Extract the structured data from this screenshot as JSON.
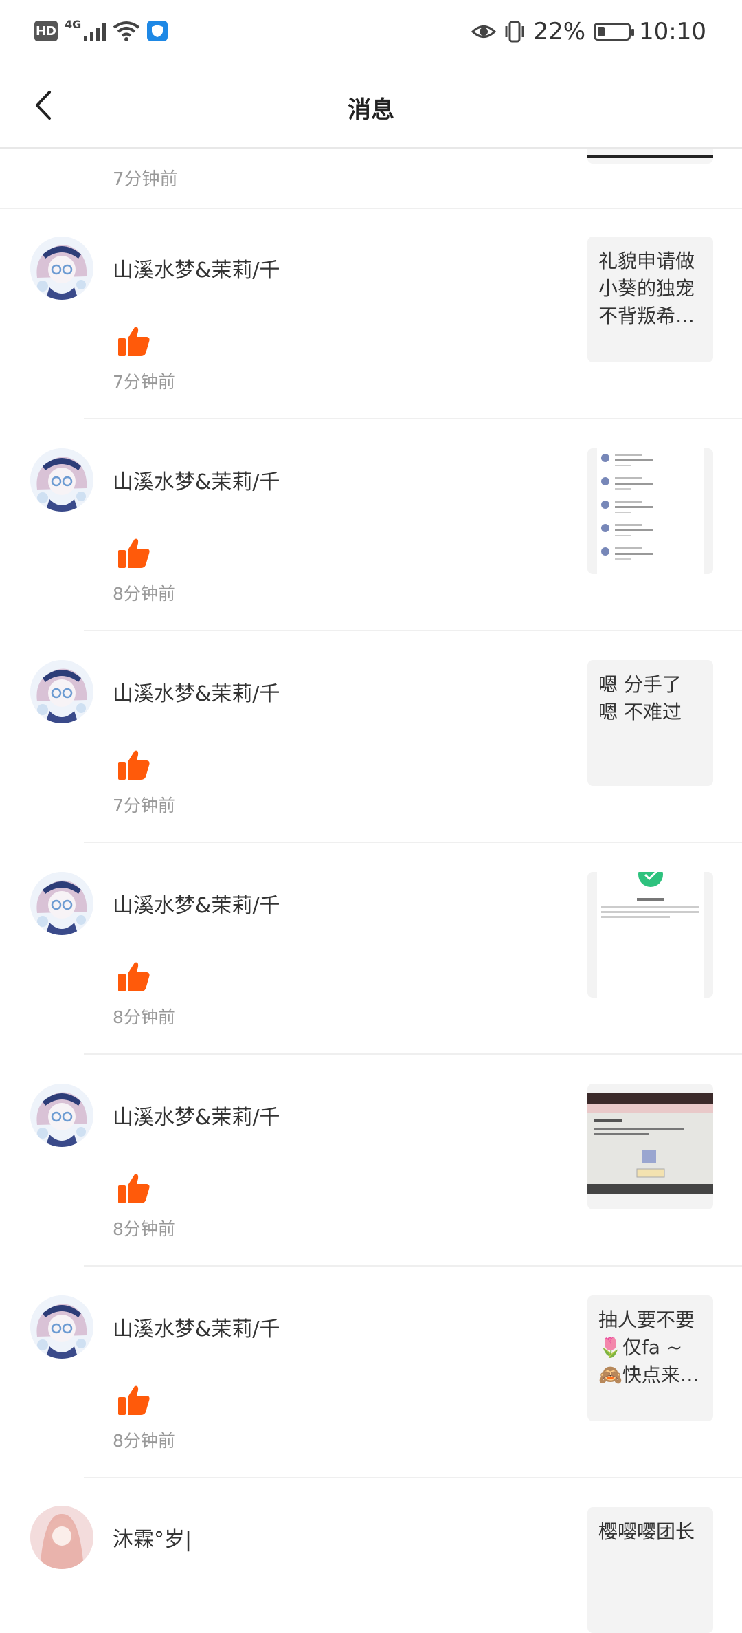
{
  "status_bar": {
    "hd": "HD",
    "network": "4G",
    "battery_percent": "22%",
    "battery_level": 0.22,
    "time": "10:10",
    "icons": [
      "signal-icon",
      "wifi-icon",
      "shield-app-icon",
      "eye-icon",
      "vibrate-icon",
      "battery-icon"
    ]
  },
  "header": {
    "title": "消息",
    "back_icon": "chevron-left-icon"
  },
  "top_partial": {
    "time": "7分钟前"
  },
  "items": [
    {
      "name": "山溪水梦&茉莉/千",
      "time": "7分钟前",
      "thumb_type": "text",
      "thumb_text": "礼貌申请做\n小葵的独宠\n不背叛希…"
    },
    {
      "name": "山溪水梦&茉莉/千",
      "time": "8分钟前",
      "thumb_type": "image-chatlist",
      "thumb_text": ""
    },
    {
      "name": "山溪水梦&茉莉/千",
      "time": "7分钟前",
      "thumb_type": "text",
      "thumb_text": "嗯   分手了\n嗯   不难过"
    },
    {
      "name": "山溪水梦&茉莉/千",
      "time": "8分钟前",
      "thumb_type": "image-success",
      "thumb_text": ""
    },
    {
      "name": "山溪水梦&茉莉/千",
      "time": "8分钟前",
      "thumb_type": "image-dialog",
      "thumb_text": ""
    },
    {
      "name": "山溪水梦&茉莉/千",
      "time": "8分钟前",
      "thumb_type": "text",
      "thumb_text": "抽人要不要\n🌷仅fa ~\n🙈快点来…"
    }
  ],
  "bottom_partial": {
    "name": "沐霖°岁|",
    "thumb_text": "樱嘤嘤团长"
  },
  "colors": {
    "like": "#ff5a0a",
    "time": "#999999",
    "divider": "#efefef",
    "thumb_bg": "#f3f3f3"
  }
}
